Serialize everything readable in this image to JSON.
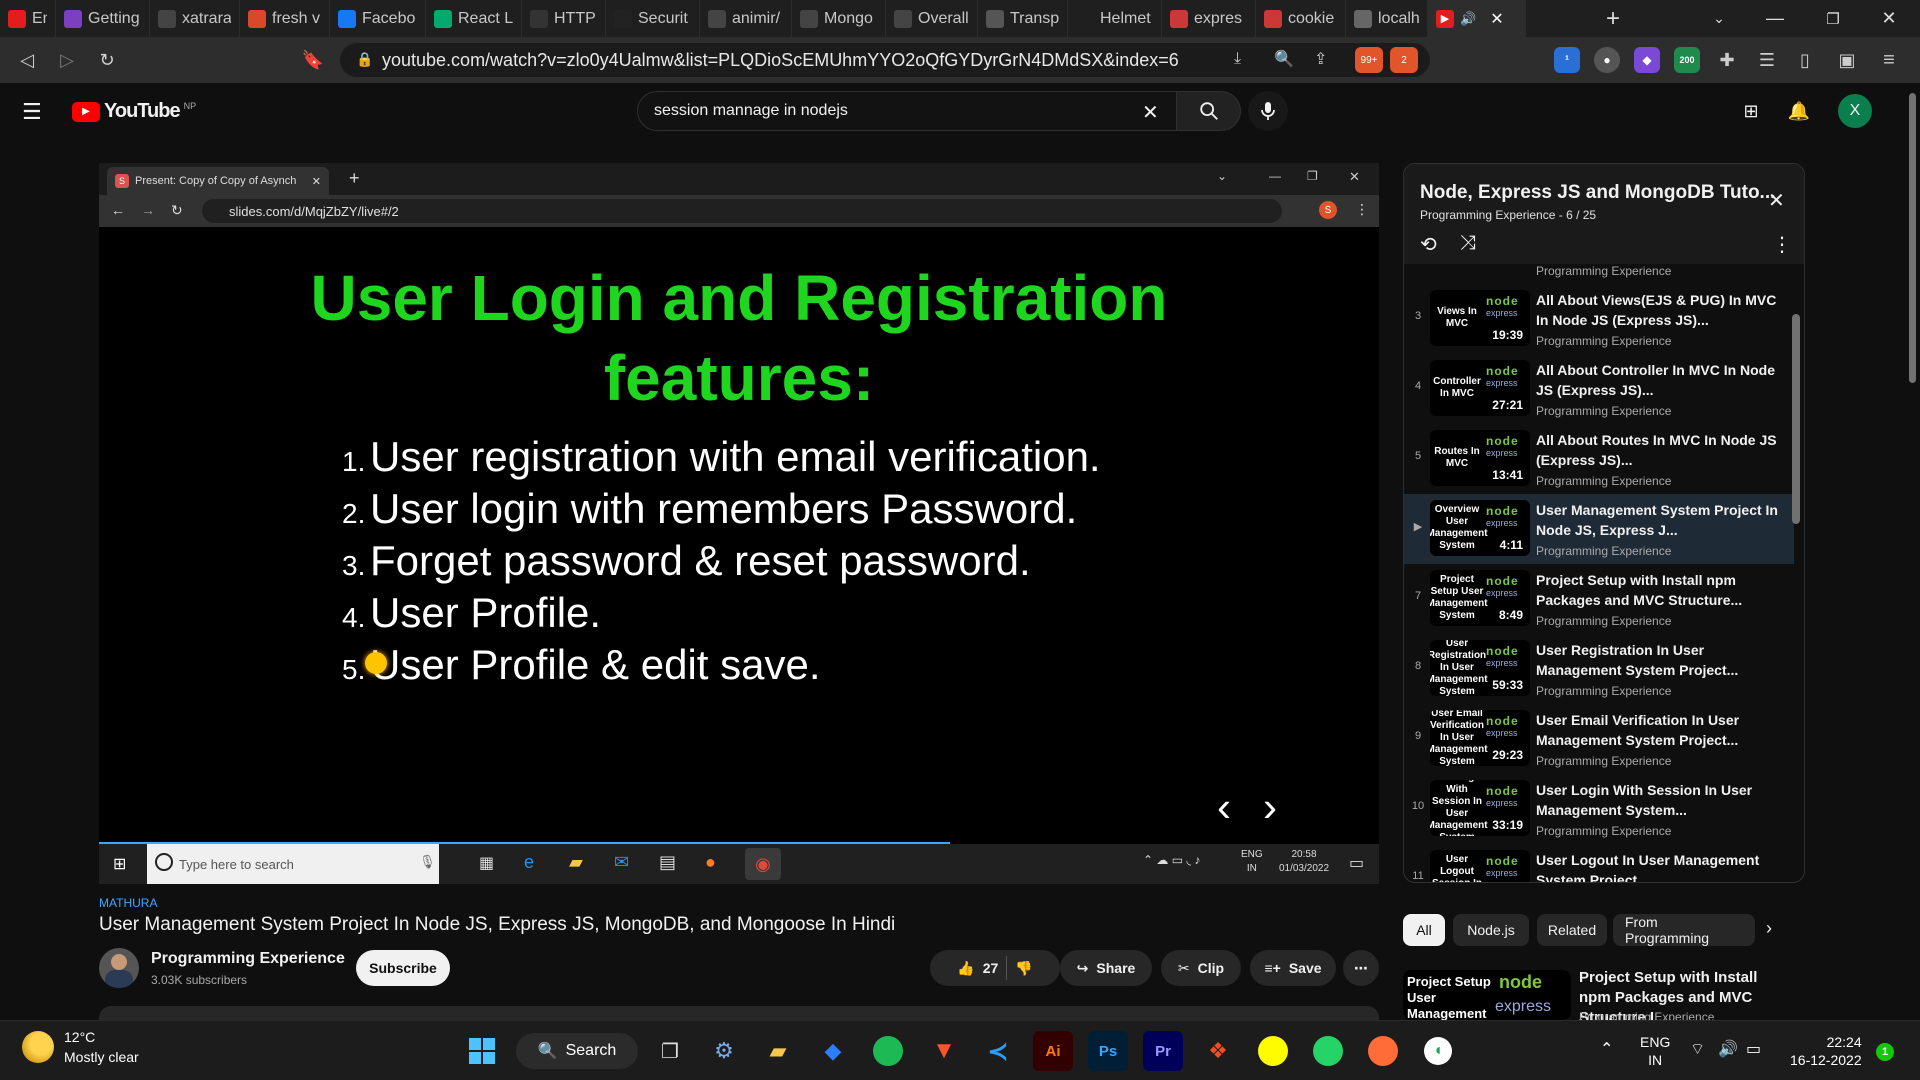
{
  "browser": {
    "tabs": [
      {
        "label": "Enc",
        "icon": "youtube-icon",
        "color": "#e11d1d"
      },
      {
        "label": "Getting",
        "icon": "heroku-icon",
        "color": "#7b3fbf"
      },
      {
        "label": "xatrara",
        "icon": "github-icon",
        "color": "#444444"
      },
      {
        "label": "fresh v",
        "icon": "brave-icon",
        "color": "#d9482b"
      },
      {
        "label": "Facebo",
        "icon": "facebook-icon",
        "color": "#1877f2"
      },
      {
        "label": "React L",
        "icon": "w3schools-icon",
        "color": "#04aa6d"
      },
      {
        "label": "HTTP r",
        "icon": "mdn-icon",
        "color": "#333333"
      },
      {
        "label": "Securit",
        "icon": "express-icon",
        "color": "#222222"
      },
      {
        "label": "animir/",
        "icon": "github-icon",
        "color": "#444444"
      },
      {
        "label": "Mongo",
        "icon": "github-icon",
        "color": "#444444"
      },
      {
        "label": "Overall",
        "icon": "github-icon",
        "color": "#444444"
      },
      {
        "label": "Transp",
        "icon": "wikipedia-icon",
        "color": "#555555"
      },
      {
        "label": "Helmet",
        "icon": "helmet-icon",
        "color": "#1f1f1f"
      },
      {
        "label": "expres",
        "icon": "npm-icon",
        "color": "#cb3837"
      },
      {
        "label": "cookie",
        "icon": "npm-icon",
        "color": "#cb3837"
      },
      {
        "label": "localho",
        "icon": "globe-icon",
        "color": "#666666"
      }
    ],
    "url": "youtube.com/watch?v=zlo0y4Ualmw&list=PLQDioScEMUhmYYO2oQfGYDyrGrN4DMdSX&index=6",
    "brave_badge": "99+",
    "alert_badge": "2",
    "ext_badge": "200"
  },
  "youtube": {
    "logo": "YouTube",
    "region": "NP",
    "search_query": "session mannage in nodejs",
    "avatar_letter": "X"
  },
  "player": {
    "inner_tab_title": "Present: Copy of Copy of Asynch",
    "inner_url": "slides.com/d/MqjZbZY/live#/2",
    "slide_title_line1": "User Login and Registration",
    "slide_title_line2": "features:",
    "slide_items": [
      {
        "num": "1.",
        "text": "User registration with email verification."
      },
      {
        "num": "2.",
        "text": "User login with remembers Password."
      },
      {
        "num": "3.",
        "text": "Forget password & reset password."
      },
      {
        "num": "4.",
        "text": "User Profile."
      },
      {
        "num": "5.",
        "text": "User Profile & edit save."
      }
    ],
    "win_search_placeholder": "Type here to search",
    "win_lang": "ENG",
    "win_lang2": "IN",
    "win_time": "20:58",
    "win_date": "01/03/2022",
    "progress_fraction": 0.665
  },
  "video": {
    "location": "MATHURA",
    "title": "User Management System Project In Node JS, Express JS, MongoDB, and Mongoose In Hindi",
    "channel": "Programming Experience",
    "subscribers": "3.03K subscribers",
    "subscribe_label": "Subscribe",
    "likes": "27",
    "share_label": "Share",
    "clip_label": "Clip",
    "save_label": "Save"
  },
  "playlist": {
    "title": "Node, Express JS and MongoDB Tuto...",
    "channel": "Programming Experience",
    "position": "6 / 25",
    "top_partial_channel": "Programming Experience",
    "items": [
      {
        "idx": "3",
        "thumb": "Views In MVC",
        "duration": "19:39",
        "title": "All About Views(EJS & PUG) In MVC In Node JS (Express JS)...",
        "channel": "Programming Experience",
        "current": false
      },
      {
        "idx": "4",
        "thumb": "Controller In MVC",
        "duration": "27:21",
        "title": "All About Controller In MVC In Node JS (Express JS)...",
        "channel": "Programming Experience",
        "current": false
      },
      {
        "idx": "5",
        "thumb": "Routes In MVC",
        "duration": "13:41",
        "title": "All About Routes In MVC In Node JS (Express JS)...",
        "channel": "Programming Experience",
        "current": false
      },
      {
        "idx": "▶",
        "thumb": "Overview User Management System",
        "duration": "4:11",
        "title": "User Management System Project In Node JS, Express J...",
        "channel": "Programming Experience",
        "current": true
      },
      {
        "idx": "7",
        "thumb": "Project Setup User Management System",
        "duration": "8:49",
        "title": "Project Setup with Install npm Packages and MVC Structure...",
        "channel": "Programming Experience",
        "current": false
      },
      {
        "idx": "8",
        "thumb": "User Registration In User Management System",
        "duration": "59:33",
        "title": "User Registration In User Management System Project...",
        "channel": "Programming Experience",
        "current": false
      },
      {
        "idx": "9",
        "thumb": "User Email Verification In User Management System",
        "duration": "29:23",
        "title": "User Email Verification In User Management System Project...",
        "channel": "Programming Experience",
        "current": false
      },
      {
        "idx": "10",
        "thumb": "User Login With Session In User Management System",
        "duration": "33:19",
        "title": "User Login With Session In User Management System...",
        "channel": "Programming Experience",
        "current": false
      },
      {
        "idx": "11",
        "thumb": "User Logout Session In User",
        "duration": "",
        "title": "User Logout In User Management System Project...",
        "channel": "",
        "current": false
      }
    ]
  },
  "chips": [
    "All",
    "Node.js",
    "Related",
    "From Programming"
  ],
  "related": {
    "thumb": "Project Setup User Management",
    "title": "Project Setup with Install npm Packages and MVC Structure I...",
    "channel": "Programming Experience"
  },
  "taskbar": {
    "weather_temp": "12°C",
    "weather_desc": "Mostly clear",
    "search_label": "Search",
    "lang": "ENG",
    "lang2": "IN",
    "time": "22:24",
    "date": "16-12-2022",
    "notif_count": "1"
  }
}
